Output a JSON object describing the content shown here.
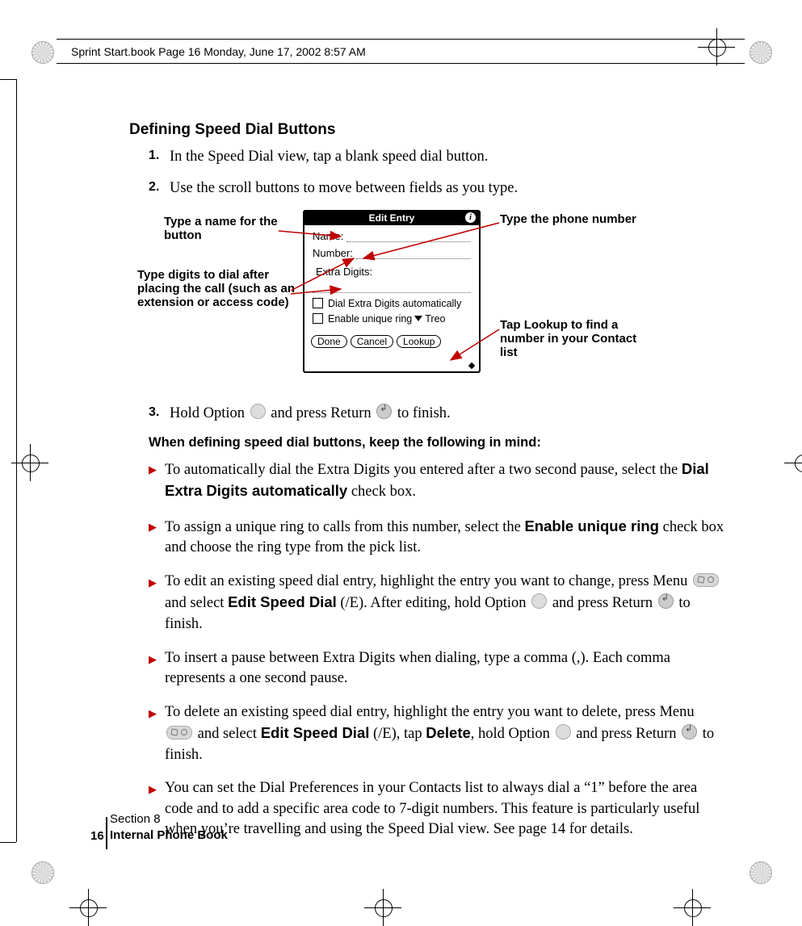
{
  "header": "Sprint Start.book  Page 16  Monday, June 17, 2002  8:57 AM",
  "title": "Defining Speed Dial Buttons",
  "steps": {
    "s1": {
      "num": "1.",
      "text": "In the Speed Dial view, tap a blank speed dial button."
    },
    "s2": {
      "num": "2.",
      "text": "Use the scroll buttons to move between fields as you type."
    },
    "s3": {
      "num": "3.",
      "pre": "Hold Option ",
      "mid": " and press Return ",
      "post": " to finish."
    }
  },
  "figure": {
    "title": "Edit Entry",
    "name_label": "Name:",
    "number_label": "Number:",
    "extra_label": "Extra Digits:",
    "chk1": "Dial Extra Digits automatically",
    "chk2_pre": "Enable unique ring ",
    "chk2_post": " Treo",
    "btn_done": "Done",
    "btn_cancel": "Cancel",
    "btn_lookup": "Lookup"
  },
  "callouts": {
    "c1": "Type a name for the button",
    "c2": "Type digits to dial after placing the call (such as an extension or access code)",
    "c3": "Type the phone number",
    "c4": "Tap Lookup to find a number in your Contact list"
  },
  "note_heading": "When defining speed dial buttons, keep the following in mind:",
  "bullets": {
    "b1": {
      "pre": "To automatically dial the Extra Digits you entered after a two second pause, select the ",
      "bold1": "Dial Extra Digits automatically",
      "post": " check box."
    },
    "b2": {
      "pre": "To assign a unique ring to calls from this number, select the ",
      "bold1": "Enable unique ring",
      "post": " check box and choose the ring type from the pick list."
    },
    "b3": {
      "pre": "To edit an existing speed dial entry, highlight the entry you want to change, press Menu ",
      "mid1": " and select ",
      "bold1": "Edit Speed Dial",
      "mid2": " (/E). After editing, hold Option ",
      "mid3": " and press Return ",
      "post": " to finish."
    },
    "b4": {
      "text": "To insert a pause between Extra Digits when dialing, type a comma (,). Each comma represents a one second pause."
    },
    "b5": {
      "pre": "To delete an existing speed dial entry, highlight the entry you want to delete, press Menu ",
      "mid1": " and select ",
      "bold1": "Edit Speed Dial",
      "mid2": " (/E), tap ",
      "bold2": "Delete",
      "mid3": ", hold Option ",
      "mid4": " and press Return ",
      "post": " to finish."
    },
    "b6": {
      "text": "You can set the Dial Preferences in your Contacts list to always dial a “1” before the area code and to add a specific area code to 7-digit numbers. This feature is particularly useful when you’re travelling and using the Speed Dial view. See page 14 for details."
    }
  },
  "footer": {
    "page_num": "16",
    "section": "Section 8",
    "title": "Internal Phone Book"
  }
}
